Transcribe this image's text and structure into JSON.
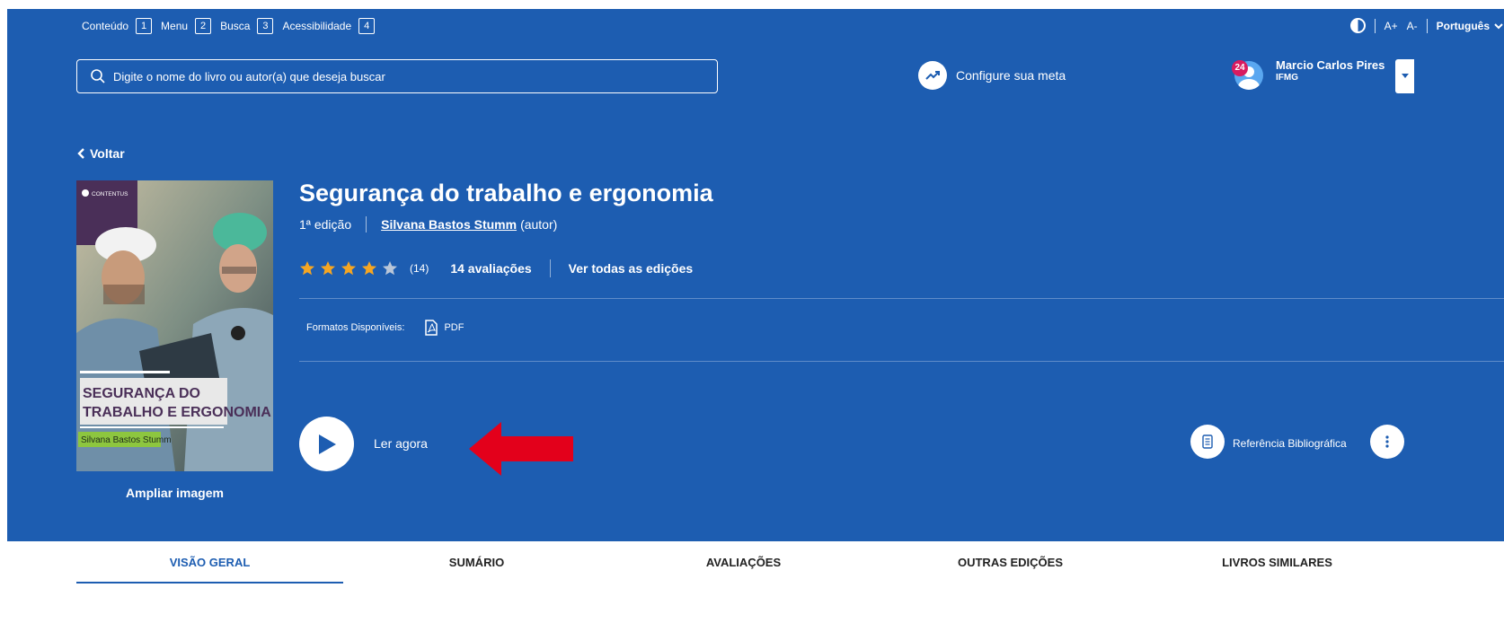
{
  "skip_links": [
    {
      "label": "Conteúdo",
      "key": "1"
    },
    {
      "label": "Menu",
      "key": "2"
    },
    {
      "label": "Busca",
      "key": "3"
    },
    {
      "label": "Acessibilidade",
      "key": "4"
    }
  ],
  "accessibility": {
    "font_increase": "A+",
    "font_decrease": "A-",
    "language": "Português"
  },
  "search": {
    "placeholder": "Digite o nome do livro ou autor(a) que deseja buscar"
  },
  "goal": {
    "label": "Configure sua meta"
  },
  "user": {
    "name": "Marcio Carlos Pires",
    "org": "IFMG",
    "notifications": "24"
  },
  "nav": {
    "back": "Voltar"
  },
  "book": {
    "cover": {
      "publisher": "CONTENTUS",
      "title_line1": "SEGURANÇA DO",
      "title_line2": "TRABALHO E ERGONOMIA",
      "author": "Silvana Bastos Stumm"
    },
    "zoom_label": "Ampliar imagem",
    "title": "Segurança do trabalho e ergonomia",
    "edition": "1ª edição",
    "author": "Silvana Bastos Stumm",
    "author_role": "(autor)",
    "rating_stars": 4,
    "rating_count": "(14)",
    "reviews_label": "14 avaliações",
    "all_editions": "Ver todas as edições",
    "formats_label": "Formatos Disponíveis:",
    "format": "PDF",
    "read_now": "Ler agora",
    "reference": "Referência Bibliográfica"
  },
  "tabs": [
    {
      "label": "VISÃO GERAL",
      "active": true
    },
    {
      "label": "SUMÁRIO",
      "active": false
    },
    {
      "label": "AVALIAÇÕES",
      "active": false
    },
    {
      "label": "OUTRAS EDIÇÕES",
      "active": false
    },
    {
      "label": "LIVROS SIMILARES",
      "active": false
    }
  ],
  "colors": {
    "brand_blue": "#1d5db1",
    "star": "#f5a623",
    "annotation_arrow": "#e3001b",
    "badge": "#d81b60"
  }
}
